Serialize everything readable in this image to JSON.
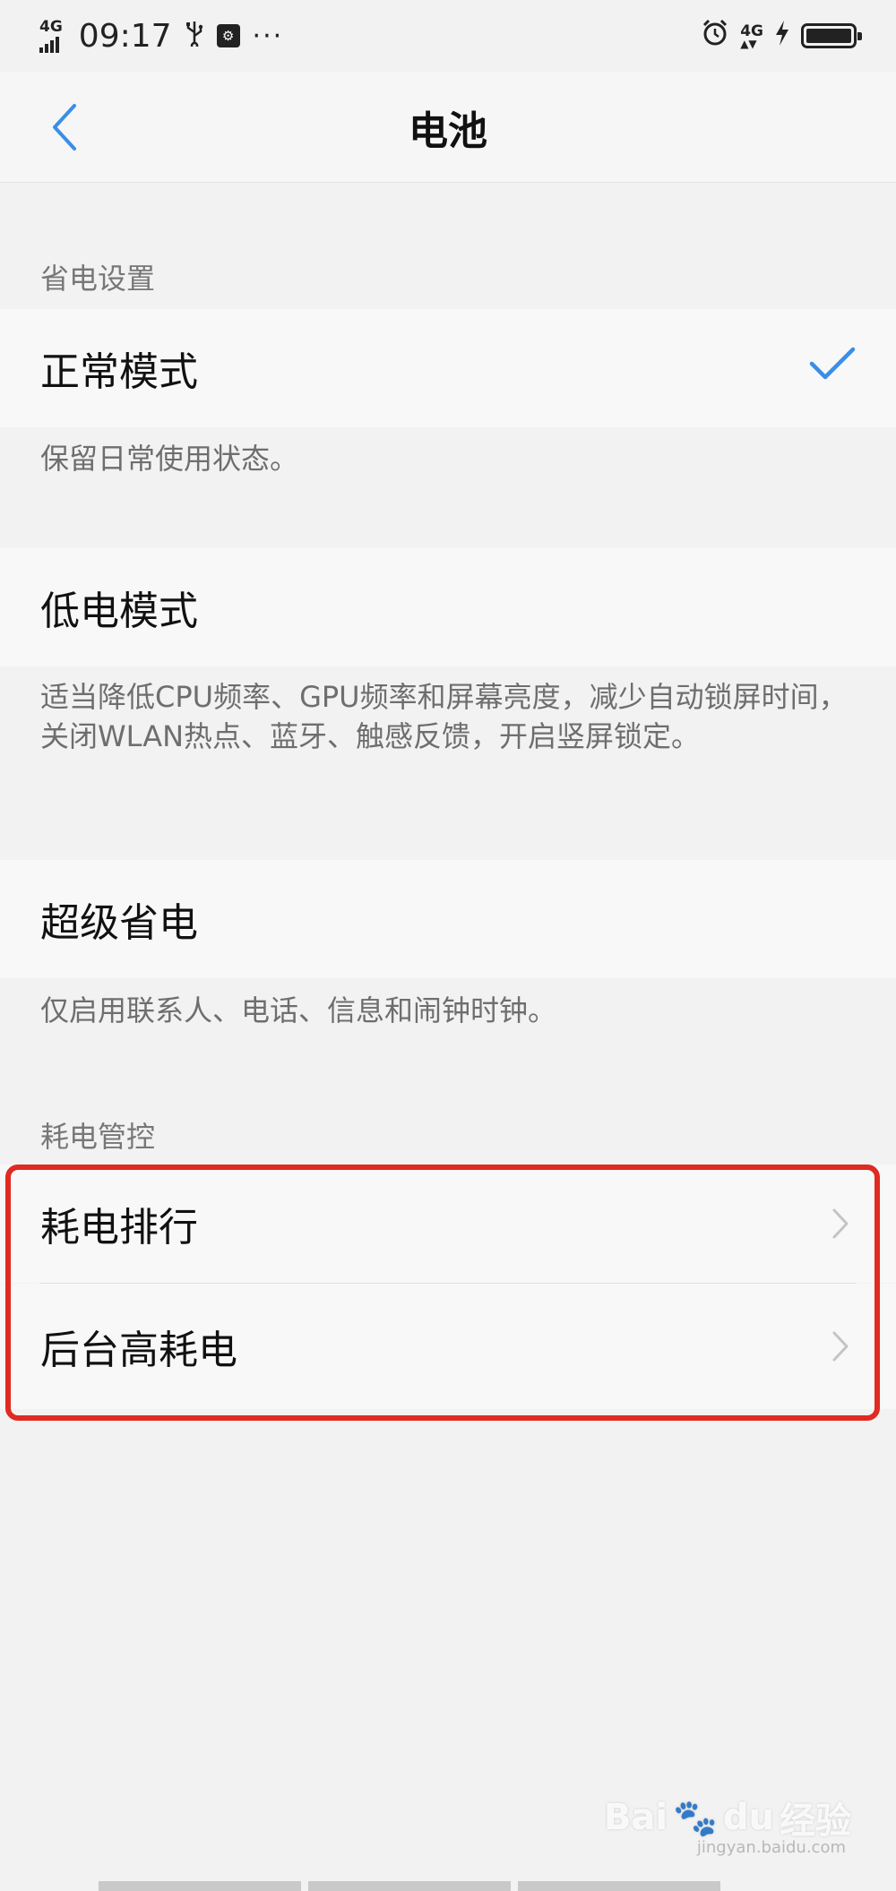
{
  "status_bar": {
    "network_left": "4G",
    "time": "09:17",
    "usb_icon": "usb-icon",
    "usb_debug_icon": "usb-debug-icon",
    "more": "···",
    "alarm_icon": "alarm-icon",
    "network_right": "4G",
    "charging_icon": "charging-icon",
    "battery_level": 1.0
  },
  "header": {
    "title": "电池",
    "back_icon": "chevron-left-icon"
  },
  "power_saving": {
    "section_label": "省电设置",
    "modes": [
      {
        "label": "正常模式",
        "selected": true,
        "description": "保留日常使用状态。"
      },
      {
        "label": "低电模式",
        "selected": false,
        "description": "适当降低CPU频率、GPU频率和屏幕亮度，减少自动锁屏时间，关闭WLAN热点、蓝牙、触感反馈，开启竖屏锁定。"
      },
      {
        "label": "超级省电",
        "selected": false,
        "description": "仅启用联系人、电话、信息和闹钟时钟。"
      }
    ]
  },
  "power_control": {
    "section_label": "耗电管控",
    "items": [
      {
        "label": "耗电排行"
      },
      {
        "label": "后台高耗电"
      }
    ]
  },
  "colors": {
    "accent": "#3a8ee6",
    "highlight": "#e02a22",
    "background": "#f2f2f2"
  },
  "watermark": {
    "brand": "Bai",
    "brand_paw": "du",
    "suffix": "经验",
    "url": "jingyan.baidu.com"
  }
}
